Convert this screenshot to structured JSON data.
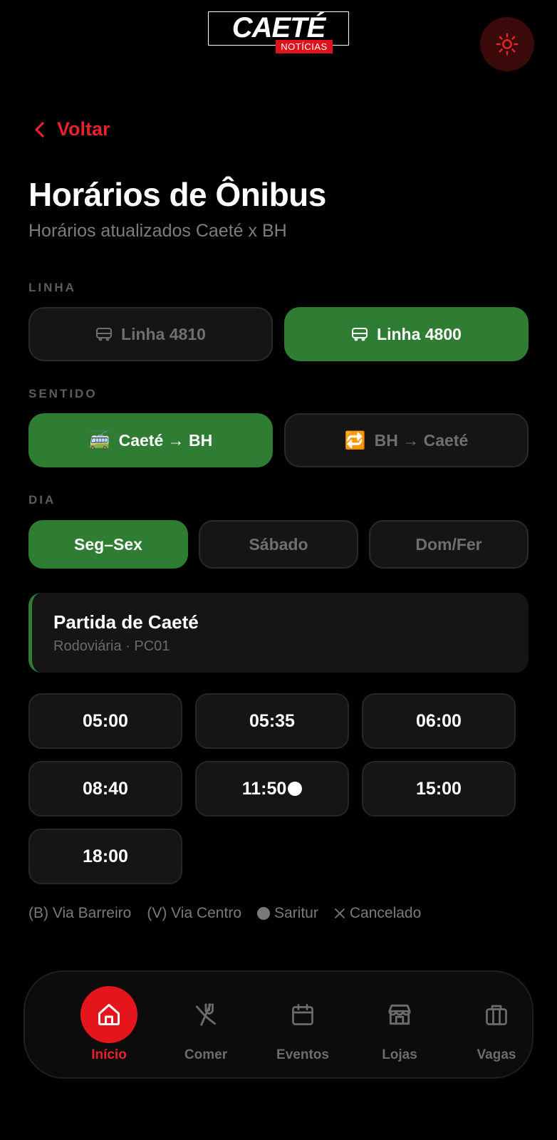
{
  "brand": {
    "name": "CAETÉ",
    "sub": "NOTÍCIAS"
  },
  "nav_back": {
    "label": "Voltar"
  },
  "page": {
    "title": "Horários de Ônibus",
    "subtitle": "Horários atualizados Caeté x BH"
  },
  "linha": {
    "label": "LINHA",
    "options": [
      {
        "label": "Linha 4810",
        "selected": false
      },
      {
        "label": "Linha 4800",
        "selected": true
      }
    ]
  },
  "sentido": {
    "label": "SENTIDO",
    "options": [
      {
        "label": "Caeté → BH",
        "emoji": "🚎",
        "selected": true
      },
      {
        "label": "BH → Caeté",
        "emoji": "🔁",
        "selected": false
      }
    ]
  },
  "dia": {
    "label": "DIA",
    "options": [
      {
        "label": "Seg–Sex",
        "selected": true
      },
      {
        "label": "Sábado",
        "selected": false
      },
      {
        "label": "Dom/Fer",
        "selected": false
      }
    ]
  },
  "departure": {
    "title": "Partida de Caeté",
    "subtitle": "Rodoviária · PC01"
  },
  "times": [
    {
      "time": "05:00",
      "saritur": false
    },
    {
      "time": "05:35",
      "saritur": false
    },
    {
      "time": "06:00",
      "saritur": false
    },
    {
      "time": "08:40",
      "saritur": false
    },
    {
      "time": "11:50",
      "saritur": true
    },
    {
      "time": "15:00",
      "saritur": false
    },
    {
      "time": "18:00",
      "saritur": false
    }
  ],
  "legend": {
    "barreiro": "(B) Via Barreiro",
    "centro": "(V) Via Centro",
    "saritur": "Saritur",
    "cancelado": "Cancelado"
  },
  "bottom_nav": [
    {
      "label": "Início",
      "icon": "home-icon",
      "active": true
    },
    {
      "label": "Comer",
      "icon": "utensils-icon",
      "active": false
    },
    {
      "label": "Eventos",
      "icon": "calendar-icon",
      "active": false
    },
    {
      "label": "Lojas",
      "icon": "store-icon",
      "active": false
    },
    {
      "label": "Vagas",
      "icon": "briefcase-icon",
      "active": false
    }
  ],
  "colors": {
    "accent_red": "#e5232a",
    "accent_green": "#2e7d32",
    "background": "#000000"
  }
}
